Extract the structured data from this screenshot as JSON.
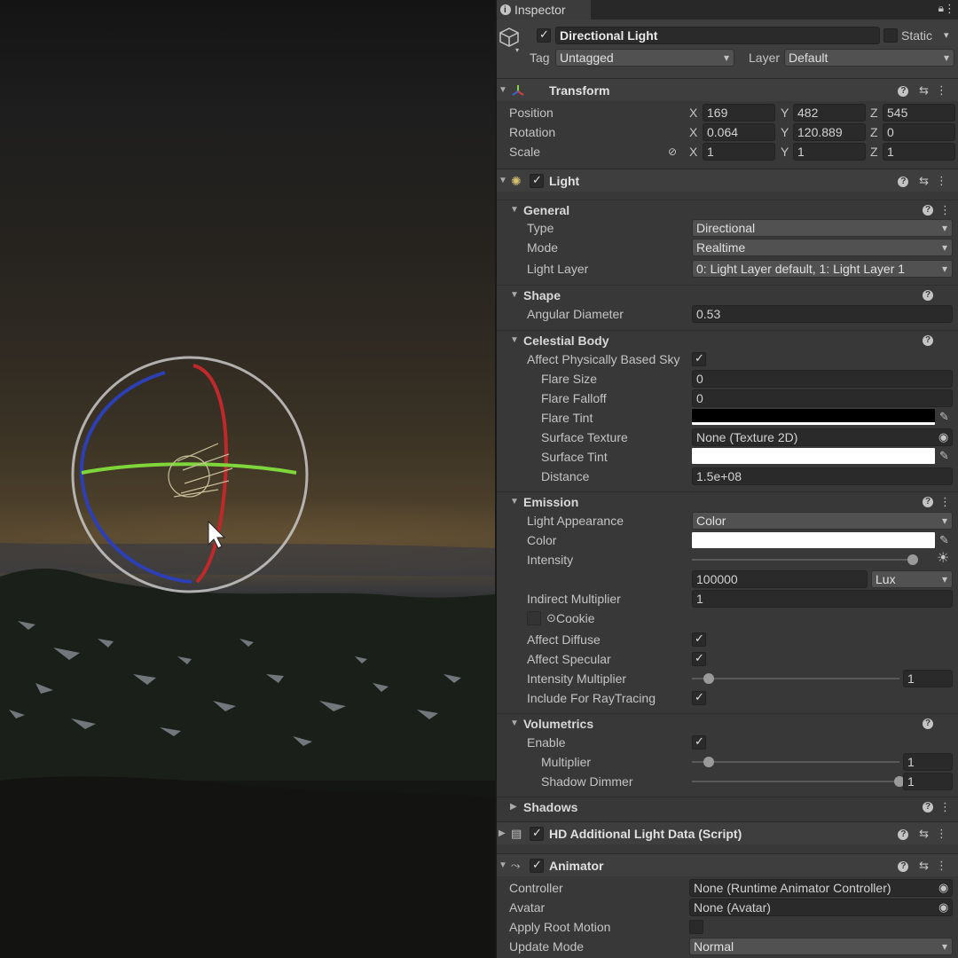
{
  "inspector": {
    "tab_label": "Inspector",
    "object": {
      "name": "Directional Light",
      "active": true,
      "static_label": "Static",
      "static_checked": false,
      "tag_label": "Tag",
      "tag_value": "Untagged",
      "layer_label": "Layer",
      "layer_value": "Default"
    },
    "transform": {
      "title": "Transform",
      "position": {
        "label": "Position",
        "x": "169",
        "y": "482",
        "z": "545"
      },
      "rotation": {
        "label": "Rotation",
        "x": "0.064",
        "y": "120.889",
        "z": "0"
      },
      "scale": {
        "label": "Scale",
        "x": "1",
        "y": "1",
        "z": "1"
      },
      "axis_x": "X",
      "axis_y": "Y",
      "axis_z": "Z"
    },
    "light": {
      "title": "Light",
      "enabled": true,
      "general": {
        "title": "General",
        "type_label": "Type",
        "type_value": "Directional",
        "mode_label": "Mode",
        "mode_value": "Realtime",
        "light_layer_label": "Light Layer",
        "light_layer_value": "0: Light Layer default, 1: Light Layer 1"
      },
      "shape": {
        "title": "Shape",
        "angular_diameter_label": "Angular Diameter",
        "angular_diameter_value": "0.53"
      },
      "celestial_body": {
        "title": "Celestial Body",
        "affect_sky_label": "Affect Physically Based Sky",
        "affect_sky_checked": true,
        "flare_size_label": "Flare Size",
        "flare_size_value": "0",
        "flare_falloff_label": "Flare Falloff",
        "flare_falloff_value": "0",
        "flare_tint_label": "Flare Tint",
        "flare_tint_color": "#000000",
        "surface_texture_label": "Surface Texture",
        "surface_texture_value": "None (Texture 2D)",
        "surface_tint_label": "Surface Tint",
        "surface_tint_color": "#ffffff",
        "distance_label": "Distance",
        "distance_value": "1.5e+08"
      },
      "emission": {
        "title": "Emission",
        "light_appearance_label": "Light Appearance",
        "light_appearance_value": "Color",
        "color_label": "Color",
        "color_value": "#ffffff",
        "intensity_label": "Intensity",
        "intensity_value": "100000",
        "intensity_unit": "Lux",
        "intensity_slider_fraction": 0.98,
        "indirect_multiplier_label": "Indirect Multiplier",
        "indirect_multiplier_value": "1",
        "cookie_label": "Cookie",
        "affect_diffuse_label": "Affect Diffuse",
        "affect_diffuse_checked": true,
        "affect_specular_label": "Affect Specular",
        "affect_specular_checked": true,
        "intensity_multiplier_label": "Intensity Multiplier",
        "intensity_multiplier_value": "1",
        "intensity_multiplier_fraction": 0.08,
        "include_raytracing_label": "Include For RayTracing",
        "include_raytracing_checked": true
      },
      "volumetrics": {
        "title": "Volumetrics",
        "enable_label": "Enable",
        "enable_checked": true,
        "multiplier_label": "Multiplier",
        "multiplier_value": "1",
        "multiplier_fraction": 0.08,
        "shadow_dimmer_label": "Shadow Dimmer",
        "shadow_dimmer_value": "1",
        "shadow_dimmer_fraction": 1.0
      },
      "shadows": {
        "title": "Shadows"
      }
    },
    "hd_additional": {
      "title": "HD Additional Light Data (Script)",
      "enabled": true
    },
    "animator": {
      "title": "Animator",
      "enabled": true,
      "controller_label": "Controller",
      "controller_value": "None (Runtime Animator Controller)",
      "avatar_label": "Avatar",
      "avatar_value": "None (Avatar)",
      "apply_root_motion_label": "Apply Root Motion",
      "apply_root_motion_checked": false,
      "update_mode_label": "Update Mode",
      "update_mode_value": "Normal"
    }
  },
  "colors": {
    "gizmo_red": "#c0282a",
    "gizmo_green": "#7ed63a",
    "gizmo_blue": "#2d3fb4",
    "gizmo_ring": "#c8c8c8"
  }
}
